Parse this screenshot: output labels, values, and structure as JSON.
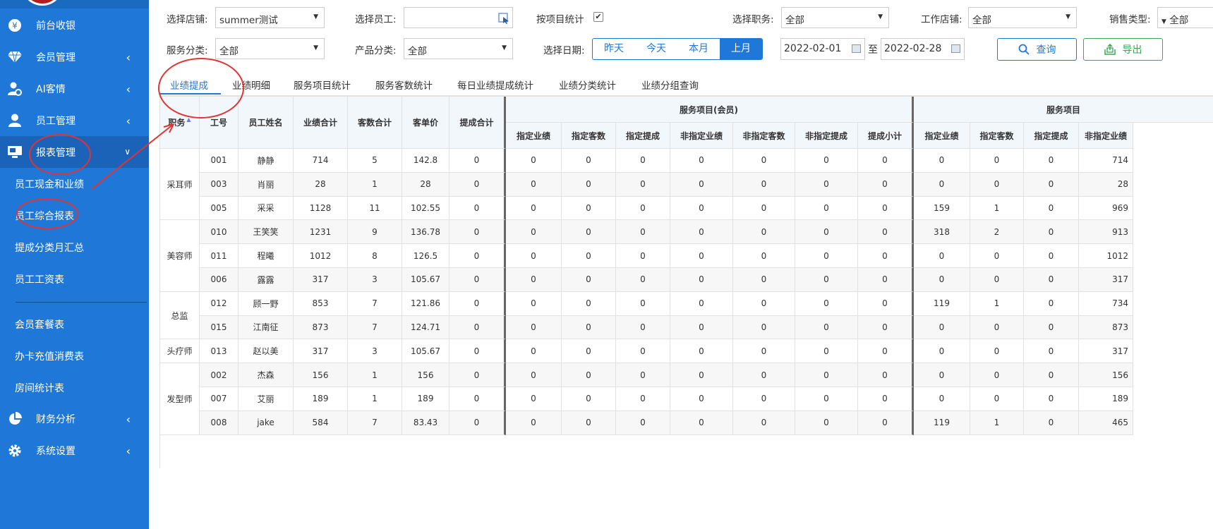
{
  "sidebar": {
    "items": [
      {
        "label": "前台收银",
        "icon": "cashier-icon",
        "chevron": false
      },
      {
        "label": "会员管理",
        "icon": "diamond-icon",
        "chevron": true
      },
      {
        "label": "AI客情",
        "icon": "user-gear-icon",
        "chevron": true
      },
      {
        "label": "员工管理",
        "icon": "user-icon",
        "chevron": true
      },
      {
        "label": "报表管理",
        "icon": "monitor-icon",
        "chevron": true,
        "expanded": true
      }
    ],
    "sub_items": [
      "员工现金和业绩",
      "员工综合报表",
      "提成分类月汇总",
      "员工工资表"
    ],
    "sub_items2": [
      "会员套餐表",
      "办卡充值消费表",
      "房间统计表"
    ],
    "bottom_items": [
      {
        "label": "财务分析",
        "icon": "pie-chart-icon"
      },
      {
        "label": "系统设置",
        "icon": "settings-icon"
      }
    ]
  },
  "filters": {
    "store_label": "选择店铺:",
    "store_value": "summer测试",
    "employee_label": "选择员工:",
    "employee_value": "",
    "by_item_label": "按项目统计",
    "by_item_checked": "✔",
    "position_label": "选择职务:",
    "position_value": "全部",
    "work_store_label": "工作店铺:",
    "work_store_value": "全部",
    "sale_type_label": "销售类型:",
    "sale_type_value": "全部",
    "service_cat_label": "服务分类:",
    "service_cat_value": "全部",
    "product_cat_label": "产品分类:",
    "product_cat_value": "全部",
    "date_label": "选择日期:",
    "date_buttons": [
      "昨天",
      "今天",
      "本月",
      "上月"
    ],
    "date_from": "2022-02-01",
    "date_to_sep": "至",
    "date_to": "2022-02-28",
    "query_label": "查询",
    "export_label": "导出"
  },
  "tabs": [
    "业绩提成",
    "业绩明细",
    "服务项目统计",
    "服务客数统计",
    "每日业绩提成统计",
    "业绩分类统计",
    "业绩分组查询"
  ],
  "table": {
    "headers": {
      "position": "职务",
      "sort_arrow": "▲",
      "id": "工号",
      "name": "员工姓名",
      "total": "业绩合计",
      "customers": "客数合计",
      "avg": "客单价",
      "commission": "提成合计",
      "group1": "服务项目(会员)",
      "group2": "服务项目",
      "sub1": [
        "指定业绩",
        "指定客数",
        "指定提成",
        "非指定业绩",
        "非指定客数",
        "非指定提成",
        "提成小计"
      ],
      "sub2": [
        "指定业绩",
        "指定客数",
        "指定提成",
        "非指定业绩"
      ]
    },
    "groups": [
      {
        "position": "采耳师",
        "rows": 3
      },
      {
        "position": "美容师",
        "rows": 3
      },
      {
        "position": "总监",
        "rows": 2
      },
      {
        "position": "头疗师",
        "rows": 1
      },
      {
        "position": "发型师",
        "rows": 3
      }
    ],
    "rows": [
      {
        "id": "001",
        "name": "静静",
        "total": "714",
        "cust": "5",
        "avg": "142.8",
        "comm": "0",
        "g1": [
          "0",
          "0",
          "0",
          "0",
          "0",
          "0",
          "0"
        ],
        "g2": [
          "0",
          "0",
          "0",
          "714"
        ]
      },
      {
        "id": "003",
        "name": "肖丽",
        "total": "28",
        "cust": "1",
        "avg": "28",
        "comm": "0",
        "g1": [
          "0",
          "0",
          "0",
          "0",
          "0",
          "0",
          "0"
        ],
        "g2": [
          "0",
          "0",
          "0",
          "28"
        ]
      },
      {
        "id": "005",
        "name": "采采",
        "total": "1128",
        "cust": "11",
        "avg": "102.55",
        "comm": "0",
        "g1": [
          "0",
          "0",
          "0",
          "0",
          "0",
          "0",
          "0"
        ],
        "g2": [
          "159",
          "1",
          "0",
          "969"
        ]
      },
      {
        "id": "010",
        "name": "王笑笑",
        "total": "1231",
        "cust": "9",
        "avg": "136.78",
        "comm": "0",
        "g1": [
          "0",
          "0",
          "0",
          "0",
          "0",
          "0",
          "0"
        ],
        "g2": [
          "318",
          "2",
          "0",
          "913"
        ]
      },
      {
        "id": "011",
        "name": "程曦",
        "total": "1012",
        "cust": "8",
        "avg": "126.5",
        "comm": "0",
        "g1": [
          "0",
          "0",
          "0",
          "0",
          "0",
          "0",
          "0"
        ],
        "g2": [
          "0",
          "0",
          "0",
          "1012"
        ]
      },
      {
        "id": "006",
        "name": "露露",
        "total": "317",
        "cust": "3",
        "avg": "105.67",
        "comm": "0",
        "g1": [
          "0",
          "0",
          "0",
          "0",
          "0",
          "0",
          "0"
        ],
        "g2": [
          "0",
          "0",
          "0",
          "317"
        ]
      },
      {
        "id": "012",
        "name": "顾一野",
        "total": "853",
        "cust": "7",
        "avg": "121.86",
        "comm": "0",
        "g1": [
          "0",
          "0",
          "0",
          "0",
          "0",
          "0",
          "0"
        ],
        "g2": [
          "119",
          "1",
          "0",
          "734"
        ]
      },
      {
        "id": "015",
        "name": "江南征",
        "total": "873",
        "cust": "7",
        "avg": "124.71",
        "comm": "0",
        "g1": [
          "0",
          "0",
          "0",
          "0",
          "0",
          "0",
          "0"
        ],
        "g2": [
          "0",
          "0",
          "0",
          "873"
        ]
      },
      {
        "id": "013",
        "name": "赵以美",
        "total": "317",
        "cust": "3",
        "avg": "105.67",
        "comm": "0",
        "g1": [
          "0",
          "0",
          "0",
          "0",
          "0",
          "0",
          "0"
        ],
        "g2": [
          "0",
          "0",
          "0",
          "317"
        ]
      },
      {
        "id": "002",
        "name": "杰森",
        "total": "156",
        "cust": "1",
        "avg": "156",
        "comm": "0",
        "g1": [
          "0",
          "0",
          "0",
          "0",
          "0",
          "0",
          "0"
        ],
        "g2": [
          "0",
          "0",
          "0",
          "156"
        ]
      },
      {
        "id": "007",
        "name": "艾丽",
        "total": "189",
        "cust": "1",
        "avg": "189",
        "comm": "0",
        "g1": [
          "0",
          "0",
          "0",
          "0",
          "0",
          "0",
          "0"
        ],
        "g2": [
          "0",
          "0",
          "0",
          "189"
        ]
      },
      {
        "id": "008",
        "name": "jake",
        "total": "584",
        "cust": "7",
        "avg": "83.43",
        "comm": "0",
        "g1": [
          "0",
          "0",
          "0",
          "0",
          "0",
          "0",
          "0"
        ],
        "g2": [
          "119",
          "1",
          "0",
          "465"
        ]
      }
    ]
  },
  "colors": {
    "primary": "#1f78d7",
    "annotation": "#e03333",
    "export": "#3aa856"
  }
}
